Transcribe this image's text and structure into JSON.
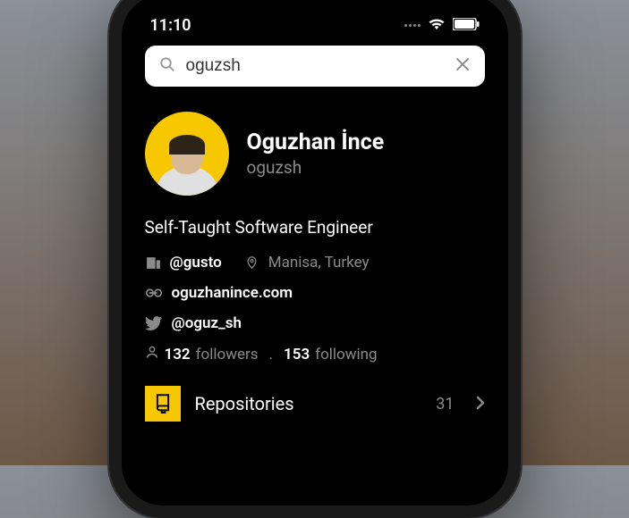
{
  "status": {
    "time": "11:10"
  },
  "search": {
    "value": "oguzsh"
  },
  "profile": {
    "display_name": "Oguzhan İnce",
    "username": "oguzsh",
    "bio": "Self-Taught Software Engineer",
    "company": "@gusto",
    "location": "Manisa, Turkey",
    "website": "oguzhanince.com",
    "twitter": "@oguz_sh",
    "followers_count": "132",
    "followers_label": "followers",
    "following_count": "153",
    "following_label": "following"
  },
  "repos": {
    "label": "Repositories",
    "count": "31"
  },
  "colors": {
    "accent": "#f7c700"
  }
}
